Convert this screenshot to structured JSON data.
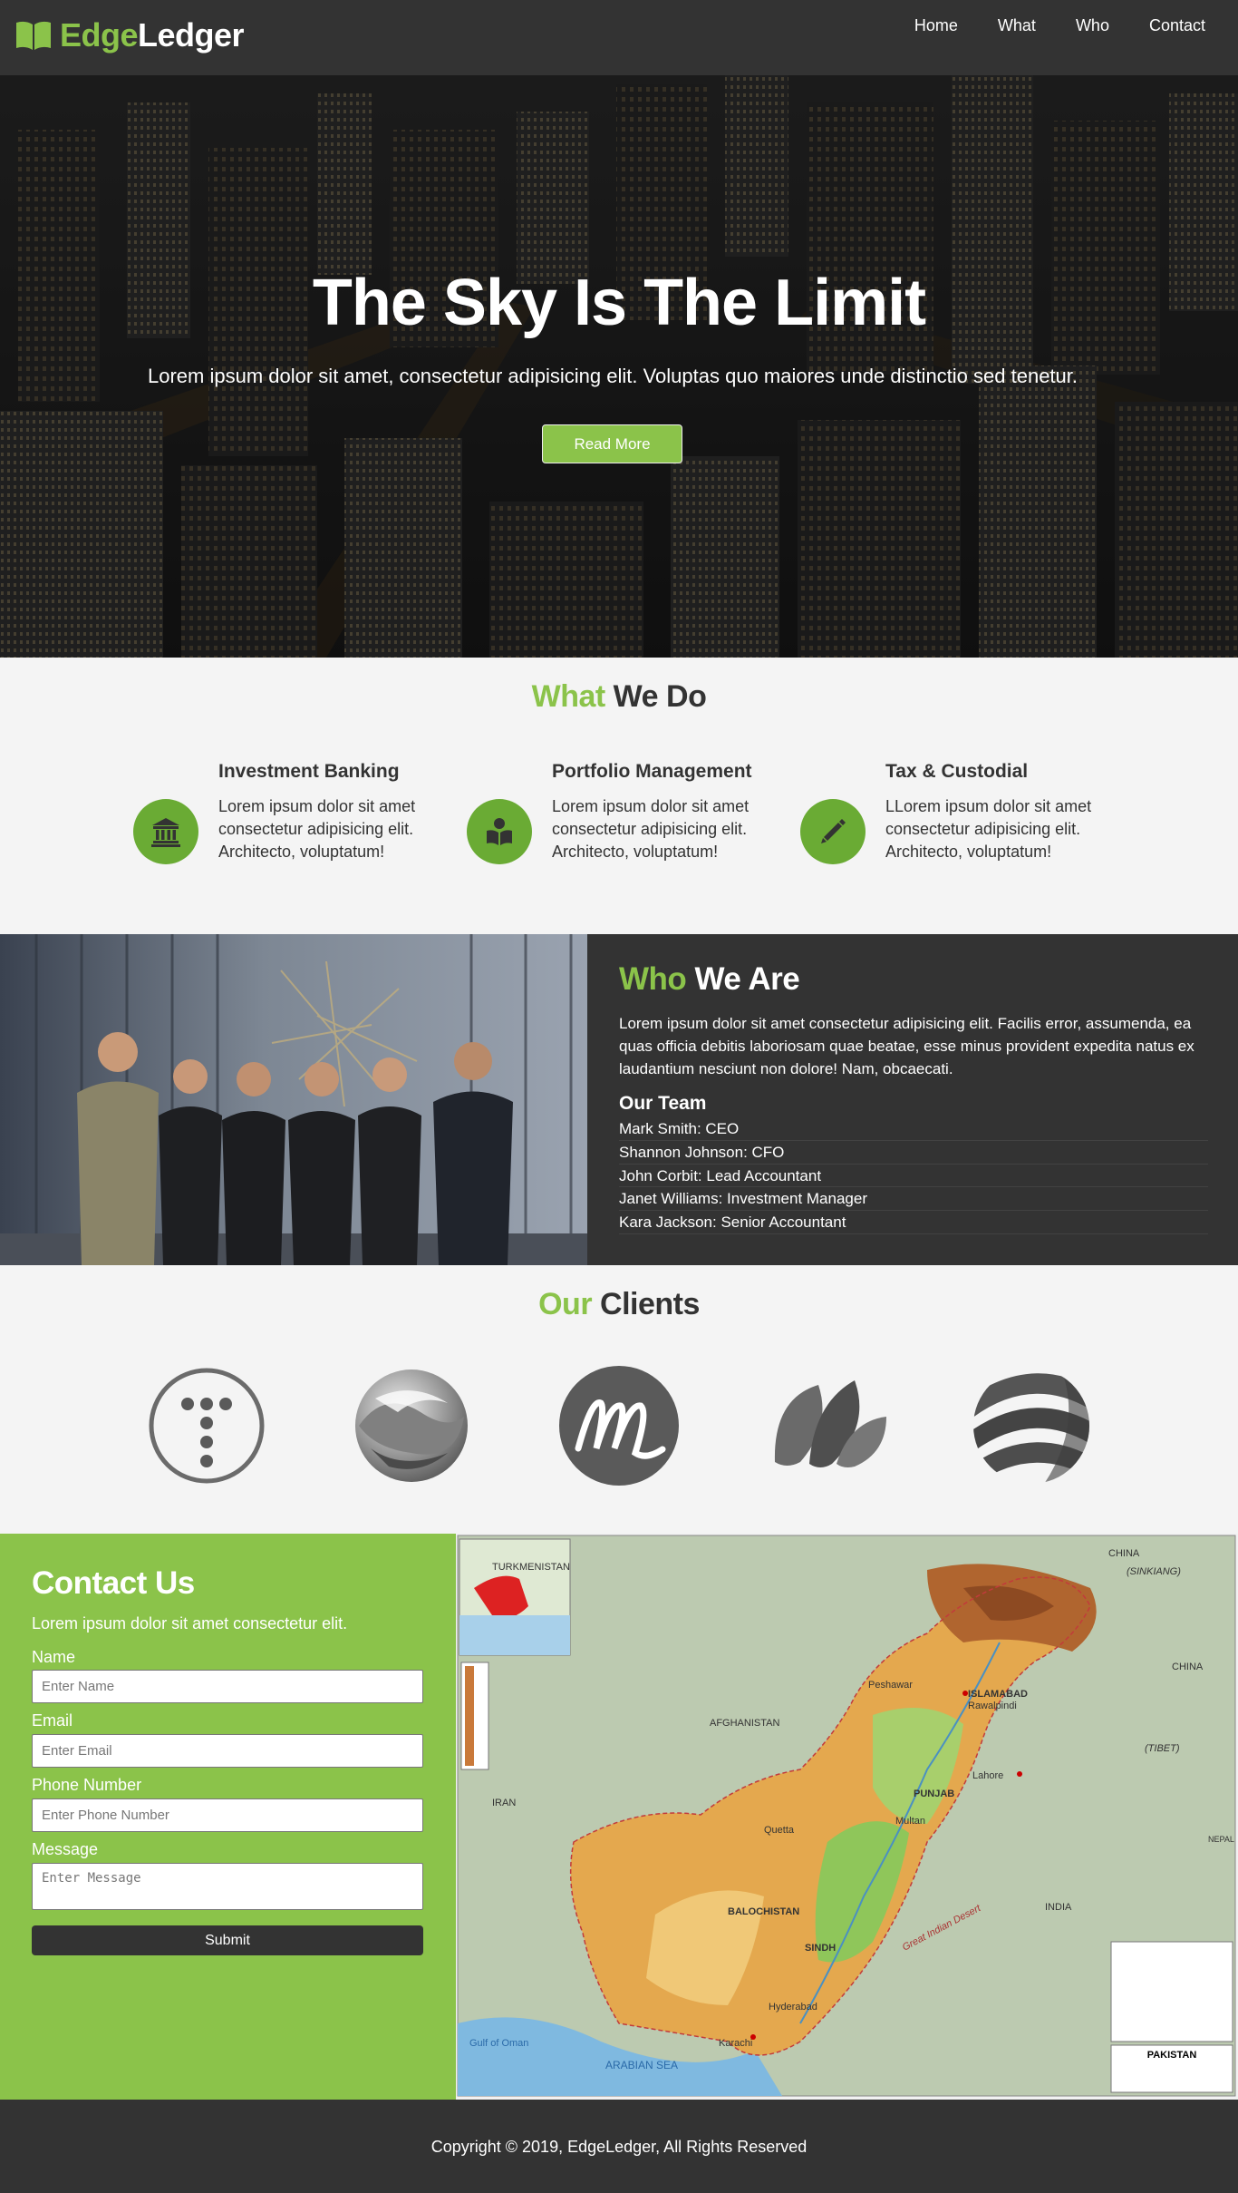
{
  "brand": {
    "part1": "Edge",
    "part2": "Ledger",
    "accent_color": "#8bc34a",
    "icon": "open-book-icon"
  },
  "nav": {
    "items": [
      "Home",
      "What",
      "Who",
      "Contact"
    ]
  },
  "hero": {
    "title": "The Sky Is The Limit",
    "text": "Lorem ipsum dolor sit amet, consectetur adipisicing elit. Voluptas quo maiores unde distinctio sed tenetur.",
    "button": "Read More"
  },
  "what": {
    "title_hl": "What",
    "title_rest": " We Do",
    "services": [
      {
        "icon": "bank-icon",
        "title": "Investment Banking",
        "text": "Lorem ipsum dolor sit amet consectetur adipisicing elit. Architecto, voluptatum!"
      },
      {
        "icon": "book-reader-icon",
        "title": "Portfolio Management",
        "text": "Lorem ipsum dolor sit amet consectetur adipisicing elit. Architecto, voluptatum!"
      },
      {
        "icon": "pencil-icon",
        "title": "Tax & Custodial",
        "text": "LLorem ipsum dolor sit amet consectetur adipisicing elit. Architecto, voluptatum!"
      }
    ]
  },
  "who": {
    "title_hl": "Who",
    "title_rest": " We Are",
    "intro": "Lorem ipsum dolor sit amet consectetur adipisicing elit. Facilis error, assumenda, ea quas officia debitis laboriosam quae beatae, esse minus provident expedita natus ex laudantium nesciunt non dolore! Nam, obcaecati.",
    "team_title": "Our Team",
    "team": [
      "Mark Smith: CEO",
      "Shannon Johnson: CFO",
      "John Corbit: Lead Accountant",
      "Janet Williams: Investment Manager",
      "Kara Jackson: Senior Accountant"
    ]
  },
  "clients": {
    "title_hl": "Our",
    "title_rest": " Clients"
  },
  "contact": {
    "title": "Contact Us",
    "subtitle": "Lorem ipsum dolor sit amet consectetur elit.",
    "name_label": "Name",
    "name_placeholder": "Enter Name",
    "email_label": "Email",
    "email_placeholder": "Enter Email",
    "phone_label": "Phone Number",
    "phone_placeholder": "Enter Phone Number",
    "message_label": "Message",
    "message_placeholder": "Enter Message",
    "submit": "Submit"
  },
  "map": {
    "labels": {
      "turkmenistan": "TURKMENISTAN",
      "china": "CHINA",
      "china2": "CHINA",
      "sinkiang": "(SINKIANG)",
      "tibet": "(TIBET)",
      "afghanistan": "AFGHANISTAN",
      "iran": "IRAN",
      "india": "INDIA",
      "nepal": "NEPAL",
      "islamabad": "ISLAMABAD",
      "rawalpindi": "Rawalpindi",
      "peshawar": "Peshawar",
      "lahore": "Lahore",
      "multan": "Multan",
      "quetta": "Quetta",
      "hyderabad": "Hyderabad",
      "karachi": "Karachi",
      "balochistan": "BALOCHISTAN",
      "punjab": "PUNJAB",
      "sindh": "SINDH",
      "arabian_sea": "ARABIAN SEA",
      "gulf_of_oman": "Gulf of Oman",
      "great_indian_desert": "Great Indian Desert",
      "legend_title": "PAKISTAN"
    }
  },
  "footer": {
    "text": "Copyright © 2019, EdgeLedger, All Rights Reserved"
  }
}
